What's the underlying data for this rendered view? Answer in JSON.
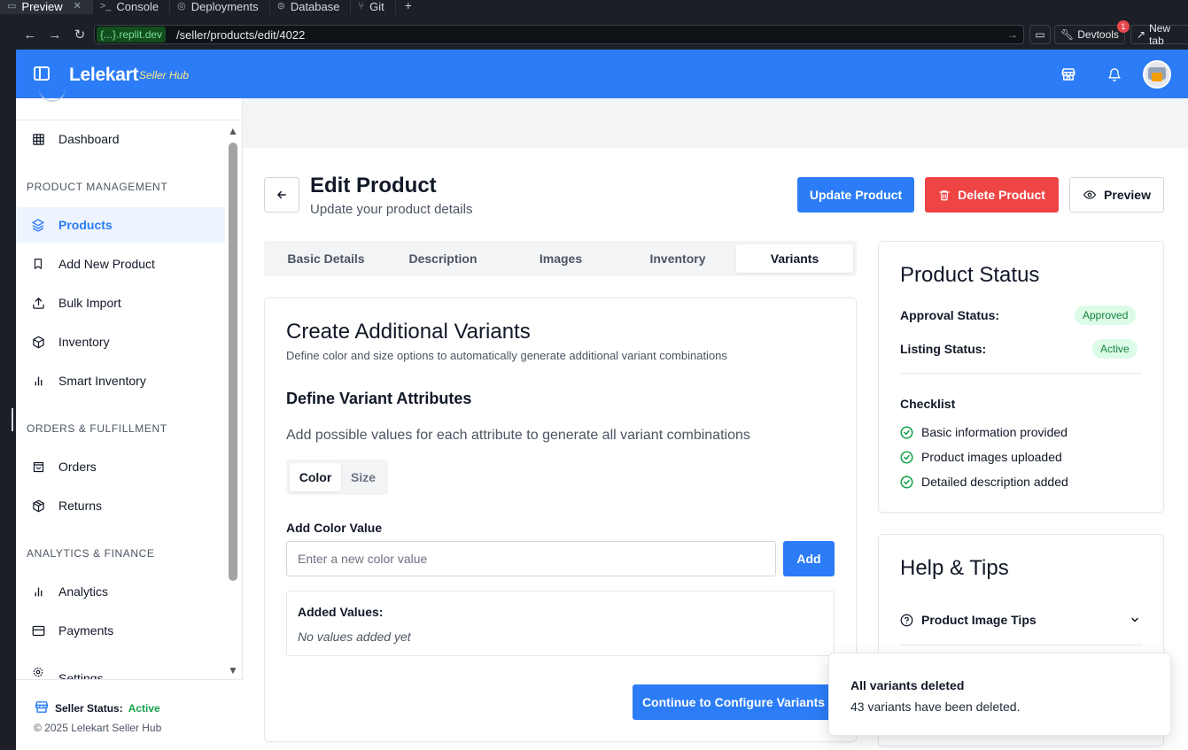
{
  "ide": {
    "tabs": [
      {
        "label": "Preview",
        "icon": "monitor-icon"
      },
      {
        "label": "Console",
        "icon": "terminal-icon"
      },
      {
        "label": "Deployments",
        "icon": "rocket-icon"
      },
      {
        "label": "Database",
        "icon": "database-icon"
      },
      {
        "label": "Git",
        "icon": "git-icon"
      }
    ],
    "new_tab_symbol": "+"
  },
  "browser": {
    "url_host": "{...}.replit.dev",
    "url_path": "/seller/products/edit/4022",
    "devtools_label": "Devtools",
    "devtools_badge": "1",
    "new_tab_label": "New tab"
  },
  "header": {
    "brand": "Lelekart",
    "brand_sub": "Seller Hub",
    "accent_color": "#2b7cf6"
  },
  "sidebar": {
    "items": [
      {
        "label": "Dashboard",
        "icon": "grid-icon"
      },
      {
        "label": "Products",
        "icon": "layers-icon",
        "active": true
      },
      {
        "label": "Add New Product",
        "icon": "bookmark-icon"
      },
      {
        "label": "Bulk Import",
        "icon": "upload-icon"
      },
      {
        "label": "Inventory",
        "icon": "box-icon"
      },
      {
        "label": "Smart Inventory",
        "icon": "bar-chart-icon"
      },
      {
        "label": "Orders",
        "icon": "shopping-bag-icon"
      },
      {
        "label": "Returns",
        "icon": "package-icon"
      },
      {
        "label": "Analytics",
        "icon": "bar-chart-icon"
      },
      {
        "label": "Payments",
        "icon": "credit-card-icon"
      },
      {
        "label": "Settings",
        "icon": "settings-icon"
      }
    ],
    "sections": [
      "PRODUCT MANAGEMENT",
      "ORDERS & FULFILLMENT",
      "ANALYTICS & FINANCE"
    ],
    "footer": {
      "status_label": "Seller Status:",
      "status_value": "Active",
      "copyright": "© 2025 Lelekart Seller Hub"
    }
  },
  "page": {
    "title": "Edit Product",
    "subtitle": "Update your product details",
    "update_label": "Update Product",
    "delete_label": "Delete Product",
    "preview_label": "Preview",
    "tabs": [
      "Basic Details",
      "Description",
      "Images",
      "Inventory",
      "Variants"
    ],
    "active_tab": "Variants"
  },
  "variants": {
    "title": "Create Additional Variants",
    "description": "Define color and size options to automatically generate additional variant combinations",
    "attributes_title": "Define Variant Attributes",
    "attributes_hint": "Add possible values for each attribute to generate all variant combinations",
    "attribute_tabs": [
      "Color",
      "Size"
    ],
    "add_label": "Add Color Value",
    "input_placeholder": "Enter a new color value",
    "input_value": "",
    "add_button": "Add",
    "added_title": "Added Values:",
    "empty_text": "No values added yet",
    "continue_label": "Continue to Configure Variants"
  },
  "status_card": {
    "title": "Product Status",
    "approval_label": "Approval Status:",
    "approval_value": "Approved",
    "listing_label": "Listing Status:",
    "listing_value": "Active",
    "checklist_title": "Checklist",
    "checklist": [
      "Basic information provided",
      "Product images uploaded",
      "Detailed description added"
    ],
    "check_color": "#16a34a"
  },
  "help_card": {
    "title": "Help & Tips",
    "items": [
      "Product Image Tips"
    ]
  },
  "toast": {
    "title": "All variants deleted",
    "message": "43 variants have been deleted."
  }
}
